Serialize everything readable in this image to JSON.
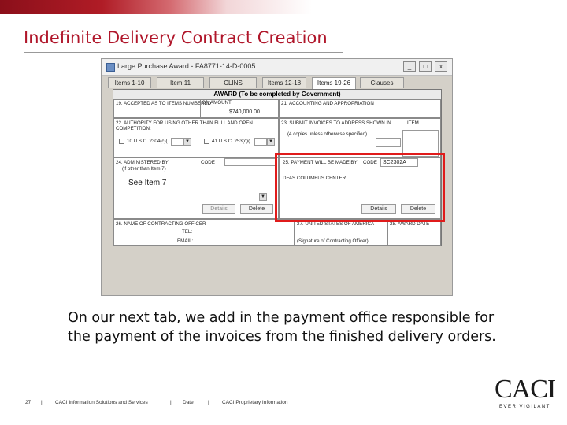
{
  "slide": {
    "title": "Indefinite Delivery Contract Creation",
    "caption": "On our next tab, we add in the payment office responsible for the payment of the invoices from the finished delivery orders."
  },
  "window": {
    "title": "Large Purchase Award - FA8771-14-D-0005",
    "buttons": [
      "_",
      "□",
      "x"
    ],
    "tabs": [
      {
        "label": "Items 1-10",
        "active": false
      },
      {
        "label": "Item 11",
        "active": false
      },
      {
        "label": "CLINS",
        "active": false
      },
      {
        "label": "Items 12-18",
        "active": false
      },
      {
        "label": "Items 19-26",
        "active": true
      },
      {
        "label": "Clauses",
        "active": false
      }
    ]
  },
  "form": {
    "header": "AWARD (To be completed by Government)",
    "block19": "19. ACCEPTED AS TO ITEMS NUMBERED",
    "block20": "20. AMOUNT",
    "amount": "$740,000.00",
    "block21": "21. ACCOUNTING AND APPROPRIATION",
    "block22": "22. AUTHORITY FOR USING OTHER THAN FULL AND OPEN COMPETITION:",
    "authority1": "10 U.S.C. 2304(c)(",
    "authority2": "41 U.S.C. 253(c)(",
    "block23": "23. SUBMIT INVOICES TO ADDRESS SHOWN IN",
    "block23_note": "(4 copies unless otherwise specified)",
    "item_label": "ITEM",
    "block24": "24. ADMINISTERED BY",
    "block24_note": "(if other than Item 7)",
    "code_label": "CODE",
    "see_item": "See Item 7",
    "details_btn": "Details",
    "delete_btn": "Delete",
    "block25": "25. PAYMENT WILL BE MADE BY",
    "code25_label": "CODE",
    "code25_value": "SC2302A",
    "payment_office": "DFAS COLUMBUS CENTER",
    "block26": "26. NAME OF CONTRACTING OFFICER",
    "tel_label": "TEL:",
    "email_label": "EMAIL:",
    "block27": "27. UNITED STATES OF AMERICA",
    "block27_note": "(Signature of Contracting Officer)",
    "block28": "28. AWARD DATE"
  },
  "footer": {
    "page": "27",
    "company": "CACI Information Solutions and Services",
    "date": "Date",
    "proprietary": "CACI Proprietary Information"
  },
  "logo": {
    "name": "CACI",
    "tagline": "EVER VIGILANT"
  },
  "colors": {
    "title": "#b0162a",
    "highlight": "#e01b1b"
  }
}
